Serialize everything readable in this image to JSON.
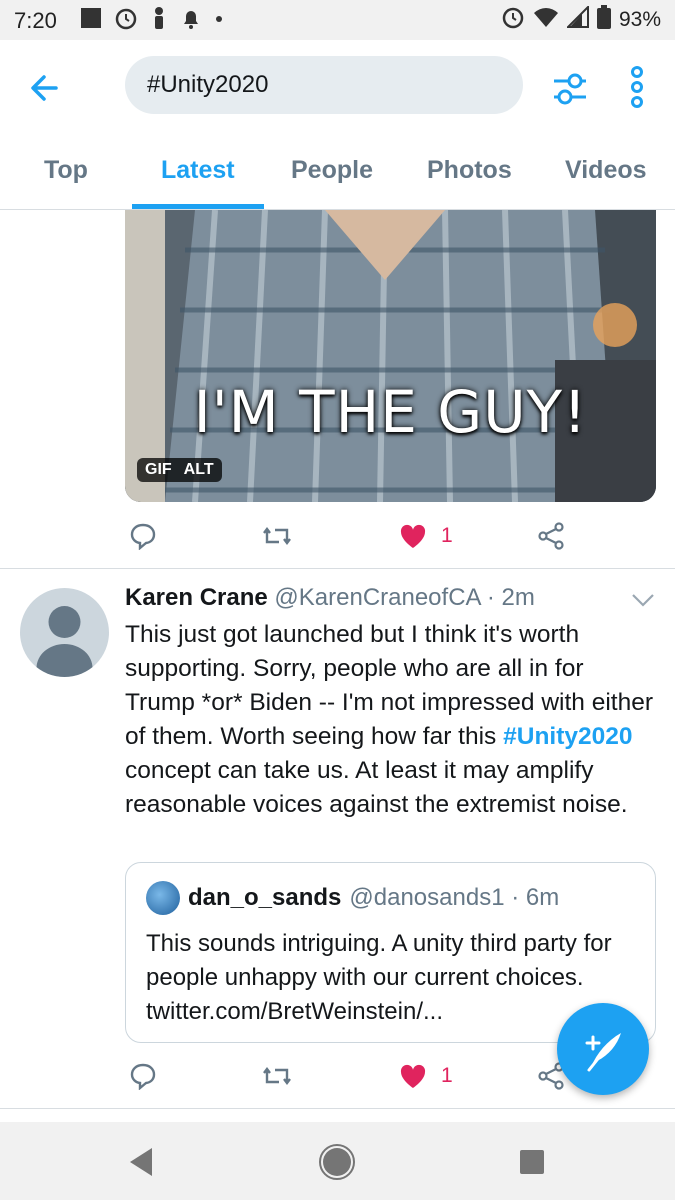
{
  "status_bar": {
    "time": "7:20",
    "battery": "93%",
    "left_icons": [
      "square-notification-icon",
      "alarm-icon",
      "person-icon",
      "bell-icon",
      "dot-icon"
    ],
    "right_icons": [
      "alarm-icon",
      "wifi-icon",
      "signal-icon",
      "battery-icon"
    ]
  },
  "header": {
    "search_value": "#Unity2020",
    "icons": [
      "back-arrow-icon",
      "filter-icon",
      "more-vertical-icon"
    ]
  },
  "tabs": [
    {
      "label": "Top",
      "active": false
    },
    {
      "label": "Latest",
      "active": true
    },
    {
      "label": "People",
      "active": false
    },
    {
      "label": "Photos",
      "active": false
    },
    {
      "label": "Videos",
      "active": false
    }
  ],
  "media": {
    "caption": "I'M THE GUY!",
    "badge_gif": "GIF",
    "badge_alt": "ALT"
  },
  "first_tweet_actions": {
    "likes": "1"
  },
  "tweet": {
    "name": "Karen Crane",
    "handle_time": "@KarenCraneofCA · 2m",
    "text_before": "This just got launched but I think it's worth supporting. Sorry, people who are all in for Trump *or* Biden -- I'm not impressed with either of them. Worth seeing how far this ",
    "hashtag": "#Unity2020",
    "text_after": " concept can take us. At least it may amplify reasonable voices against the extremist noise.",
    "likes": "1"
  },
  "quoted_tweet": {
    "name": "dan_o_sands",
    "handle_time": "@danosands1 · 6m",
    "text": "This sounds intriguing. A unity third party for people unhappy with our current choices. twitter.com/BretWeinstein/..."
  },
  "colors": {
    "accent": "#1da1f2",
    "like": "#e0245e",
    "secondary_text": "#657786",
    "search_bg": "#e6ecf0"
  }
}
